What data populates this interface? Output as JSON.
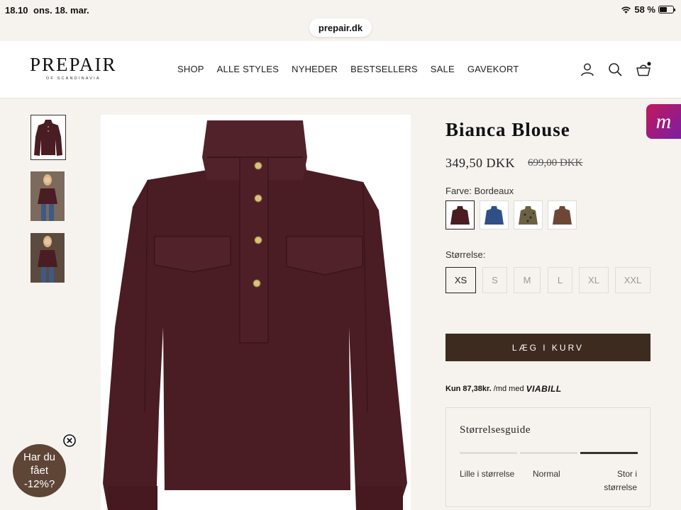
{
  "status_bar": {
    "time": "18.10",
    "date": "ons. 18. mar.",
    "battery_percent": "58 %",
    "battery_level": 0.58
  },
  "browser": {
    "url": "prepair.dk"
  },
  "header": {
    "logo_text": "PREPAIR",
    "logo_subtext": "OF SCANDINAVIA",
    "nav": [
      "SHOP",
      "ALLE STYLES",
      "NYHEDER",
      "BESTSELLERS",
      "SALE",
      "GAVEKORT"
    ],
    "icons": [
      "user-icon",
      "search-icon",
      "bag-icon"
    ]
  },
  "badge": {
    "letter": "m"
  },
  "product": {
    "title": "Bianca Blouse",
    "price": "349,50 DKK",
    "old_price": "699,00 DKK",
    "color_label": "Farve: Bordeaux",
    "swatches": [
      {
        "name": "Bordeaux",
        "color": "#4a1c24"
      },
      {
        "name": "Blue",
        "color": "#2f4f86"
      },
      {
        "name": "Leopard",
        "color": "#6b6244"
      },
      {
        "name": "Brown",
        "color": "#6e4636"
      }
    ],
    "size_label": "Størrelse:",
    "sizes": [
      "XS",
      "S",
      "M",
      "L",
      "XL",
      "XXL"
    ],
    "selected_size": "XS",
    "add_to_cart": "LÆG I KURV",
    "viabill": {
      "prefix": "Kun",
      "amount": "87,38kr.",
      "suffix": "/md med",
      "brand": "VIABILL"
    }
  },
  "size_guide": {
    "title": "Størrelsesguide",
    "labels": [
      "Lille i størrelse",
      "Normal",
      "Stor i størrelse"
    ],
    "label_small": "Lille i størrelse",
    "label_normal": "Normal",
    "label_large_line1": "Stor i",
    "label_large_line2": "størrelse",
    "active_segment": 3
  },
  "discount_bubble": {
    "text": "Har du fået -12%?",
    "line1": "Har du",
    "line2": "fået",
    "line3": "-12%?"
  },
  "colors": {
    "accent": "#3d2b1f",
    "page_bg": "#f6f3ee",
    "garment": "#4a1c24"
  }
}
